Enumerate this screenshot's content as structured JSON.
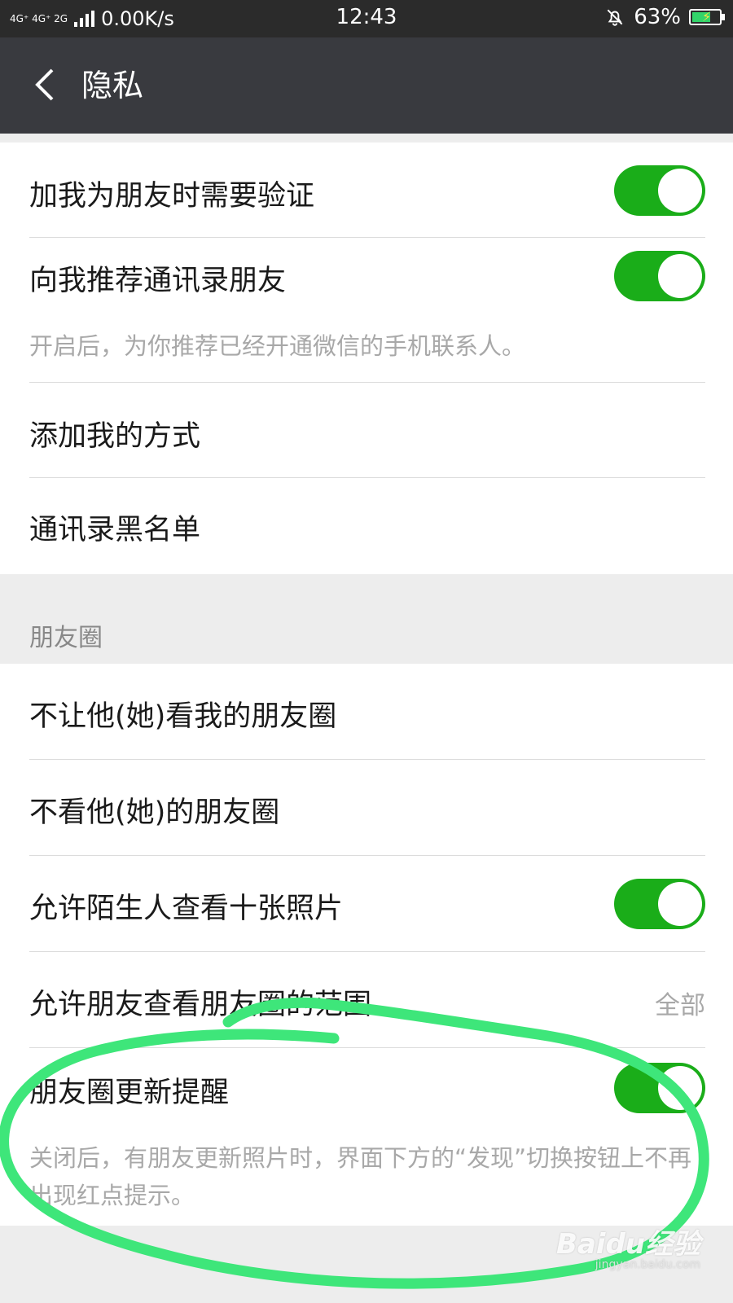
{
  "status_bar": {
    "network_text": "4G⁺ 4G⁺ 2G",
    "speed": "0.00K/s",
    "time": "12:43",
    "battery": "63%",
    "battery_level": 0.63
  },
  "header": {
    "title": "隐私",
    "back_icon": "chevron-left-icon"
  },
  "group1": {
    "items": [
      {
        "label": "加我为朋友时需要验证",
        "toggle": true
      },
      {
        "label": "向我推荐通讯录朋友",
        "toggle": true,
        "hint": "开启后，为你推荐已经开通微信的手机联系人。"
      },
      {
        "label": "添加我的方式"
      },
      {
        "label": "通讯录黑名单"
      }
    ]
  },
  "moments_section": {
    "title": "朋友圈",
    "items": [
      {
        "label": "不让他(她)看我的朋友圈"
      },
      {
        "label": "不看他(她)的朋友圈"
      },
      {
        "label": "允许陌生人查看十张照片",
        "toggle": true
      },
      {
        "label": "允许朋友查看朋友圈的范围",
        "value": "全部"
      },
      {
        "label": "朋友圈更新提醒",
        "toggle": true,
        "hint": "关闭后，有朋友更新照片时，界面下方的“发现”切换按钮上不再出现红点提示。"
      }
    ]
  },
  "watermark": {
    "brand": "Baidu经验",
    "url": "jingyan.baidu.com"
  },
  "colors": {
    "toggle_on": "#1aad19",
    "title_bar": "#393a3f",
    "annotation_stroke": "#3ee67a"
  }
}
